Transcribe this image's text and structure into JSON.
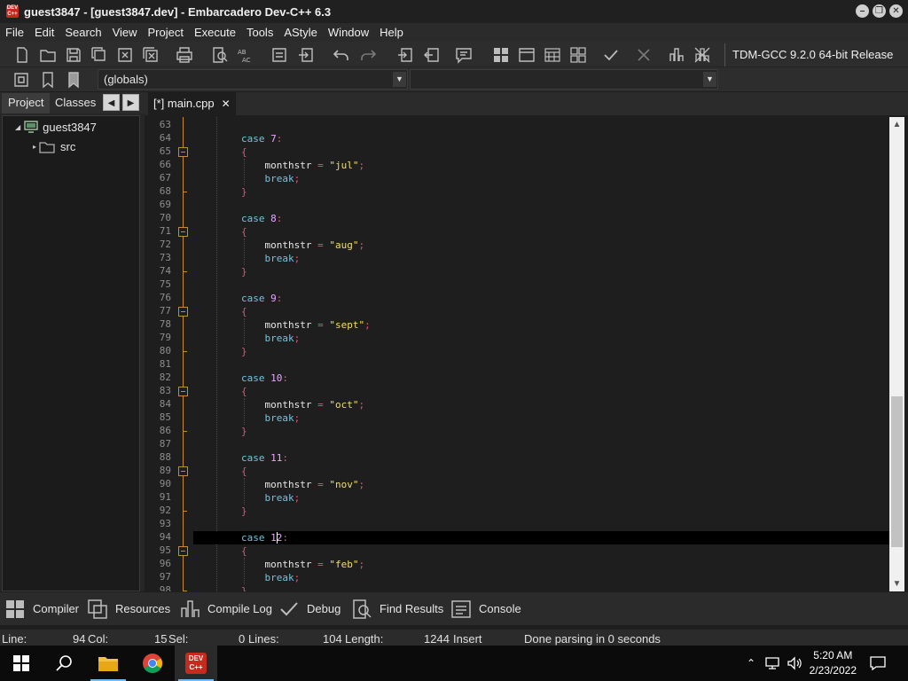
{
  "window": {
    "title": "guest3847 - [guest3847.dev] - Embarcadero Dev-C++ 6.3",
    "logo_text": "DEV C++"
  },
  "menu": [
    "File",
    "Edit",
    "Search",
    "View",
    "Project",
    "Execute",
    "Tools",
    "AStyle",
    "Window",
    "Help"
  ],
  "toolbar": {
    "compiler": "TDM-GCC 9.2.0 64-bit Release"
  },
  "combos": {
    "scope": "(globals)",
    "member": ""
  },
  "panel": {
    "tabs": [
      "Project",
      "Classes"
    ],
    "tree_root": "guest3847",
    "tree_child": "src"
  },
  "editor": {
    "tab_label": "[*] main.cpp",
    "line_numbers": [
      "63",
      "64",
      "65",
      "66",
      "67",
      "68",
      "69",
      "70",
      "71",
      "72",
      "73",
      "74",
      "75",
      "76",
      "77",
      "78",
      "79",
      "80",
      "81",
      "82",
      "83",
      "84",
      "85",
      "86",
      "87",
      "88",
      "89",
      "90",
      "91",
      "92",
      "93",
      "94",
      "95",
      "96",
      "97",
      "98"
    ],
    "lines": [
      {
        "n": "63",
        "t": []
      },
      {
        "n": "64",
        "t": [
          {
            "c": "kw",
            "s": "        case "
          },
          {
            "c": "num",
            "s": "7"
          },
          {
            "c": "pun",
            "s": ":"
          }
        ]
      },
      {
        "n": "65",
        "t": [
          {
            "c": "pun",
            "s": "        {"
          }
        ]
      },
      {
        "n": "66",
        "t": [
          {
            "c": "",
            "s": "            monthstr "
          },
          {
            "c": "pun",
            "s": "= "
          },
          {
            "c": "str",
            "s": "\"jul\""
          },
          {
            "c": "pun",
            "s": ";"
          }
        ]
      },
      {
        "n": "67",
        "t": [
          {
            "c": "kw",
            "s": "            break"
          },
          {
            "c": "pun",
            "s": ";"
          }
        ]
      },
      {
        "n": "68",
        "t": [
          {
            "c": "pun",
            "s": "        }"
          }
        ]
      },
      {
        "n": "69",
        "t": []
      },
      {
        "n": "70",
        "t": [
          {
            "c": "kw",
            "s": "        case "
          },
          {
            "c": "num",
            "s": "8"
          },
          {
            "c": "pun",
            "s": ":"
          }
        ]
      },
      {
        "n": "71",
        "t": [
          {
            "c": "pun",
            "s": "        {"
          }
        ]
      },
      {
        "n": "72",
        "t": [
          {
            "c": "",
            "s": "            monthstr "
          },
          {
            "c": "pun",
            "s": "= "
          },
          {
            "c": "str",
            "s": "\"aug\""
          },
          {
            "c": "pun",
            "s": ";"
          }
        ]
      },
      {
        "n": "73",
        "t": [
          {
            "c": "kw",
            "s": "            break"
          },
          {
            "c": "pun",
            "s": ";"
          }
        ]
      },
      {
        "n": "74",
        "t": [
          {
            "c": "pun",
            "s": "        }"
          }
        ]
      },
      {
        "n": "75",
        "t": []
      },
      {
        "n": "76",
        "t": [
          {
            "c": "kw",
            "s": "        case "
          },
          {
            "c": "num",
            "s": "9"
          },
          {
            "c": "pun",
            "s": ":"
          }
        ]
      },
      {
        "n": "77",
        "t": [
          {
            "c": "pun",
            "s": "        {"
          }
        ]
      },
      {
        "n": "78",
        "t": [
          {
            "c": "",
            "s": "            monthstr "
          },
          {
            "c": "pun",
            "s": "= "
          },
          {
            "c": "str",
            "s": "\"sept\""
          },
          {
            "c": "pun",
            "s": ";"
          }
        ]
      },
      {
        "n": "79",
        "t": [
          {
            "c": "kw",
            "s": "            break"
          },
          {
            "c": "pun",
            "s": ";"
          }
        ]
      },
      {
        "n": "80",
        "t": [
          {
            "c": "pun",
            "s": "        }"
          }
        ]
      },
      {
        "n": "81",
        "t": []
      },
      {
        "n": "82",
        "t": [
          {
            "c": "kw",
            "s": "        case "
          },
          {
            "c": "num",
            "s": "10"
          },
          {
            "c": "pun",
            "s": ":"
          }
        ]
      },
      {
        "n": "83",
        "t": [
          {
            "c": "pun",
            "s": "        {"
          }
        ]
      },
      {
        "n": "84",
        "t": [
          {
            "c": "",
            "s": "            monthstr "
          },
          {
            "c": "pun",
            "s": "= "
          },
          {
            "c": "str",
            "s": "\"oct\""
          },
          {
            "c": "pun",
            "s": ";"
          }
        ]
      },
      {
        "n": "85",
        "t": [
          {
            "c": "kw",
            "s": "            break"
          },
          {
            "c": "pun",
            "s": ";"
          }
        ]
      },
      {
        "n": "86",
        "t": [
          {
            "c": "pun",
            "s": "        }"
          }
        ]
      },
      {
        "n": "87",
        "t": []
      },
      {
        "n": "88",
        "t": [
          {
            "c": "kw",
            "s": "        case "
          },
          {
            "c": "num",
            "s": "11"
          },
          {
            "c": "pun",
            "s": ":"
          }
        ]
      },
      {
        "n": "89",
        "t": [
          {
            "c": "pun",
            "s": "        {"
          }
        ]
      },
      {
        "n": "90",
        "t": [
          {
            "c": "",
            "s": "            monthstr "
          },
          {
            "c": "pun",
            "s": "= "
          },
          {
            "c": "str",
            "s": "\"nov\""
          },
          {
            "c": "pun",
            "s": ";"
          }
        ]
      },
      {
        "n": "91",
        "t": [
          {
            "c": "kw",
            "s": "            break"
          },
          {
            "c": "pun",
            "s": ";"
          }
        ]
      },
      {
        "n": "92",
        "t": [
          {
            "c": "pun",
            "s": "        }"
          }
        ]
      },
      {
        "n": "93",
        "t": []
      },
      {
        "n": "94",
        "t": [
          {
            "c": "kw",
            "s": "        case "
          },
          {
            "c": "num",
            "s": "12"
          },
          {
            "c": "pun",
            "s": ":"
          }
        ]
      },
      {
        "n": "95",
        "t": [
          {
            "c": "pun",
            "s": "        {"
          }
        ]
      },
      {
        "n": "96",
        "t": [
          {
            "c": "",
            "s": "            monthstr "
          },
          {
            "c": "pun",
            "s": "= "
          },
          {
            "c": "str",
            "s": "\"feb\""
          },
          {
            "c": "pun",
            "s": ";"
          }
        ]
      },
      {
        "n": "97",
        "t": [
          {
            "c": "kw",
            "s": "            break"
          },
          {
            "c": "pun",
            "s": ";"
          }
        ]
      },
      {
        "n": "98",
        "t": [
          {
            "c": "pun",
            "s": "        }"
          }
        ]
      }
    ],
    "fold_lines": [
      "65",
      "71",
      "77",
      "83",
      "89",
      "95"
    ],
    "current_line": "94",
    "current_line_color": "#000000"
  },
  "bottom_tabs": [
    "Compiler",
    "Resources",
    "Compile Log",
    "Debug",
    "Find Results",
    "Console"
  ],
  "status": {
    "line_label": "Line:",
    "line_val": "94",
    "col_label": "Col:",
    "col_val": "15",
    "sel_label": "Sel:",
    "sel_val": "0",
    "lines_label": "Lines:",
    "lines_val": "104",
    "length_label": "Length:",
    "length_val": "1244",
    "mode": "Insert",
    "message": "Done parsing in 0 seconds"
  },
  "taskbar": {
    "time": "5:20 AM",
    "date": "2/23/2022"
  },
  "colors": {
    "keyword": "#74c3e0",
    "number": "#e6a8ff",
    "string": "#f2df6a",
    "punct": "#e05575",
    "fold": "#c78a2e"
  }
}
